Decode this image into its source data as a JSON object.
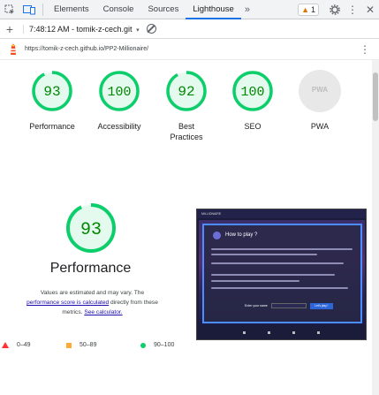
{
  "devtools": {
    "tabs": [
      "Elements",
      "Console",
      "Sources",
      "Lighthouse"
    ],
    "active_tab": "Lighthouse",
    "more_tabs": "»",
    "issues_count": "1"
  },
  "lighthouse_bar": {
    "report": "7:48:12 AM - tomik-z-cech.git",
    "caret": "▾"
  },
  "url_row": {
    "url": "https://tomik-z-cech.github.io/PP2-Millionaire/",
    "menu": "⋮"
  },
  "gauges": [
    {
      "label": "Performance",
      "score": 93,
      "color": "#0cce6b"
    },
    {
      "label": "Accessibility",
      "score": 100,
      "color": "#0cce6b"
    },
    {
      "label": "Best Practices",
      "score": 92,
      "color": "#0cce6b"
    },
    {
      "label": "SEO",
      "score": 100,
      "color": "#0cce6b"
    },
    {
      "label": "PWA",
      "score_text": "PWA",
      "color": "#cccccc"
    }
  ],
  "performance": {
    "score": 93,
    "title": "Performance",
    "note_1": "Values are estimated and may vary. The",
    "note_link_1": "performance score is calculated",
    "note_2": " directly from these",
    "note_3": "metrics.",
    "note_link_2": "See calculator."
  },
  "legend": [
    {
      "label": "0–49",
      "color": "#ff3333"
    },
    {
      "label": "50–89",
      "color": "#ffaa33"
    },
    {
      "label": "90–100",
      "color": "#0cce6b"
    }
  ],
  "thumbnail": {
    "app_name": "MILLIONAIRE",
    "modal_title": "How to play ?",
    "input_label": "Enter your name",
    "button_label": "Let's play !"
  }
}
